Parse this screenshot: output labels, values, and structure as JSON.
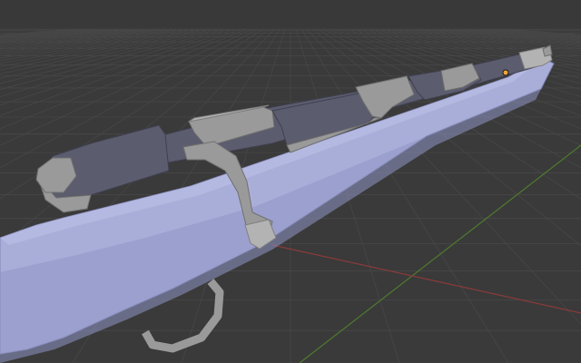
{
  "viewport": {
    "background_color": "#3a3a3a",
    "grid_color": "#474747",
    "x_axis_color": "#8a3b3b",
    "y_axis_color": "#4f7b2e"
  },
  "model": {
    "type": "rifle-mesh",
    "stock_color": "#a9aed9",
    "stock_shadow_color": "#8f95c4",
    "barrel_dark_color": "#5b5c6e",
    "metal_color": "#9a9a9a",
    "metal_light_color": "#b3b3b3",
    "origin_color": "#f2a33a"
  }
}
